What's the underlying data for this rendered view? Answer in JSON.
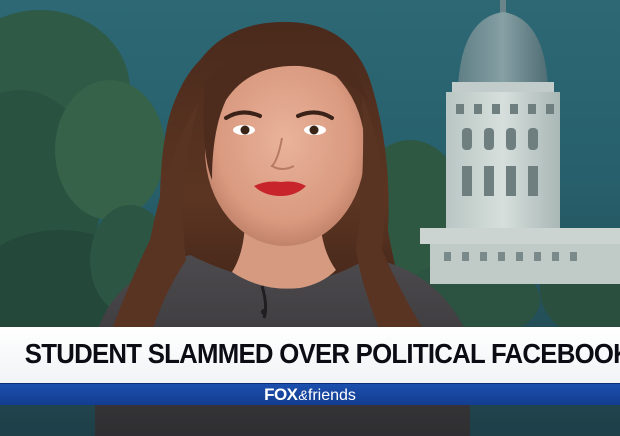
{
  "broadcast": {
    "headline": "STUDENT SLAMMED OVER POLITICAL FACEBOOK POST",
    "network": "FOX",
    "network_amp": "&",
    "show": "friends"
  },
  "colors": {
    "headline_bar": "#ffffff",
    "headline_text": "#0c0c14",
    "brand_strip": "#1c4fae",
    "backdrop": "#2d6874",
    "lipstick": "#c8242c"
  }
}
